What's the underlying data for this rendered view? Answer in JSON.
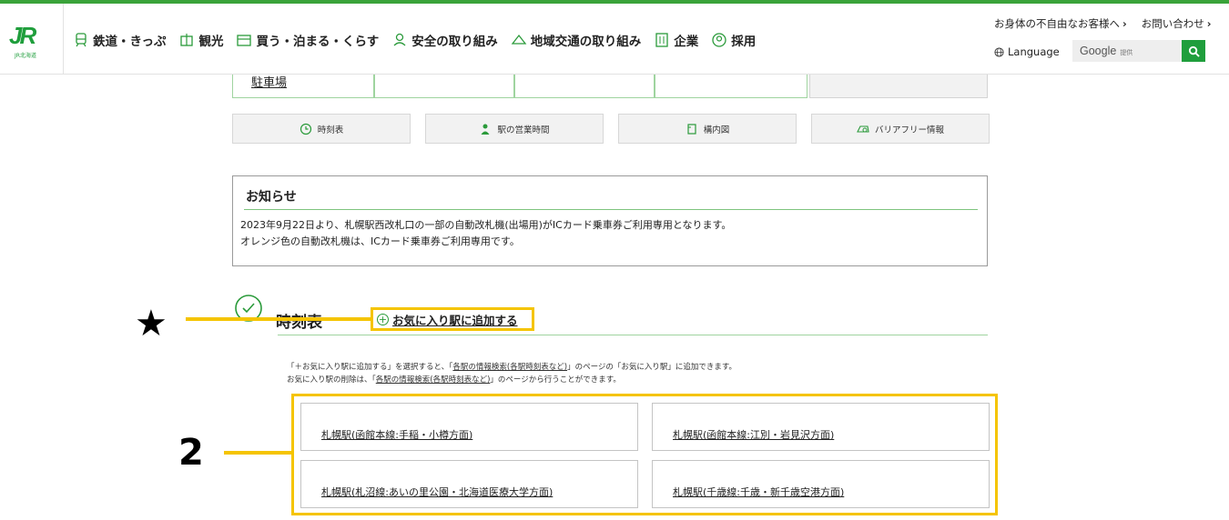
{
  "header": {
    "logo_text": "JR",
    "logo_sub": "JR北海道",
    "nav": [
      {
        "label": "鉄道・きっぷ",
        "icon": "train-icon"
      },
      {
        "label": "観光",
        "icon": "sightseeing-icon"
      },
      {
        "label": "買う・泊まる・くらす",
        "icon": "shop-icon"
      },
      {
        "label": "安全の取り組み",
        "icon": "safety-icon"
      },
      {
        "label": "地域交通の取り組み",
        "icon": "regional-transport-icon"
      },
      {
        "label": "企業",
        "icon": "building-icon"
      },
      {
        "label": "採用",
        "icon": "recruit-icon"
      }
    ],
    "util_links": [
      "お身体の不自由なお客様へ",
      "お問い合わせ"
    ],
    "language": "Language",
    "search_brand": "Google",
    "search_tag": "提供"
  },
  "partial_row": {
    "parking_label": "駐車場"
  },
  "quick_buttons": [
    {
      "label": "時刻表",
      "icon": "clock-icon"
    },
    {
      "label": "駅の営業時間",
      "icon": "person-icon"
    },
    {
      "label": "構内図",
      "icon": "map-icon"
    },
    {
      "label": "バリアフリー情報",
      "icon": "barrier-free-icon"
    }
  ],
  "notice": {
    "title": "お知らせ",
    "line1": "2023年9月22日より、札幌駅西改札口の一部の自動改札機(出場用)がICカード乗車券ご利用専用となります。",
    "line2": "オレンジ色の自動改札機は、ICカード乗車券ご利用専用です。"
  },
  "timetable": {
    "title": "時刻表",
    "add_favorite": "お気に入り駅に追加する",
    "info_line1_a": "「＋お気に入り駅に追加する」を選択すると、「",
    "info_line1_link": "各駅の情報検索(各駅時刻表など)",
    "info_line1_b": "」のページの「お気に入り駅」に追加できます。",
    "info_line2_a": "お気に入り駅の削除は、「",
    "info_line2_link": "各駅の情報検索(各駅時刻表など)",
    "info_line2_b": "」のページから行うことができます。",
    "stations": [
      "札幌駅(函館本線:手稲・小樽方面)",
      "札幌駅(函館本線:江別・岩見沢方面)",
      "札幌駅(札沼線:あいの里公園・北海道医療大学方面)",
      "札幌駅(千歳線:千歳・新千歳空港方面)"
    ]
  },
  "annotations": {
    "star": "★",
    "number": "2",
    "highlight_color": "#f5c400"
  },
  "colors": {
    "accent": "#1f9e3c",
    "border_green": "#9fd49f"
  }
}
